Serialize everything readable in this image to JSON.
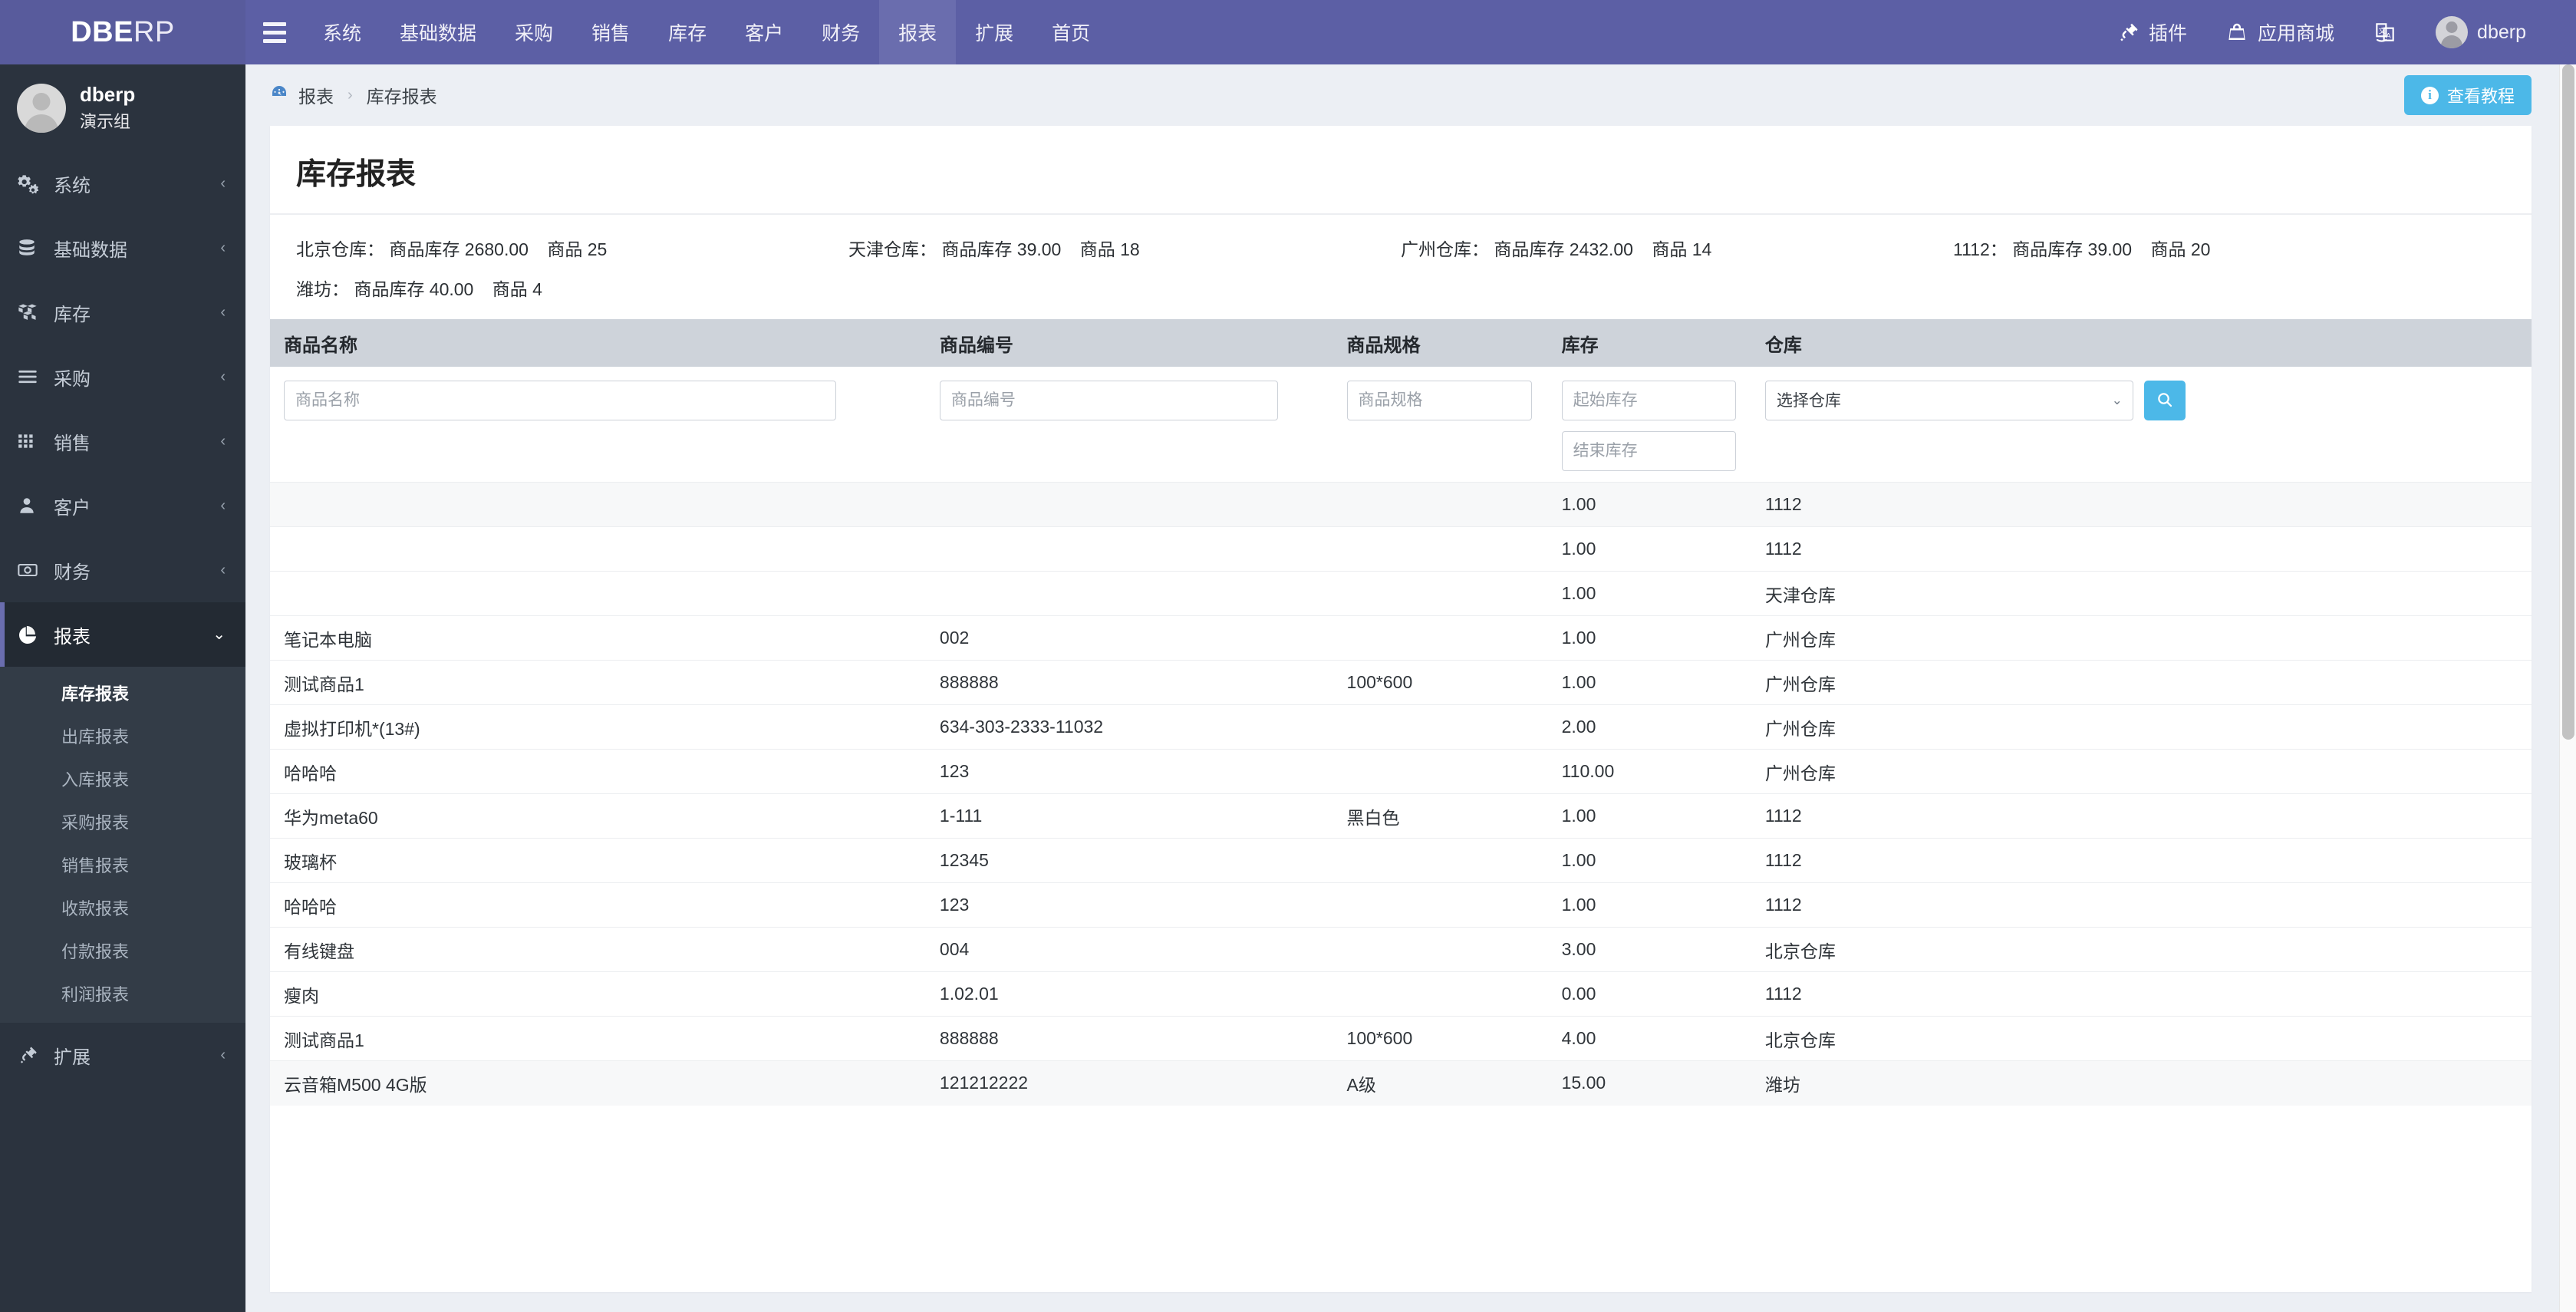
{
  "navbar": {
    "brand_bold": "DBE",
    "brand_light": "RP",
    "toggle_icon": "hamburger-icon",
    "items": [
      {
        "label": "系统",
        "active": false
      },
      {
        "label": "基础数据",
        "active": false
      },
      {
        "label": "采购",
        "active": false
      },
      {
        "label": "销售",
        "active": false
      },
      {
        "label": "库存",
        "active": false
      },
      {
        "label": "客户",
        "active": false
      },
      {
        "label": "财务",
        "active": false
      },
      {
        "label": "报表",
        "active": true
      },
      {
        "label": "扩展",
        "active": false
      },
      {
        "label": "首页",
        "active": false
      }
    ],
    "right": {
      "plugin_label": "插件",
      "store_label": "应用商城",
      "translate_icon": "translate-icon",
      "user_label": "dberp"
    }
  },
  "sidebar": {
    "profile": {
      "name": "dberp",
      "group": "演示组"
    },
    "items": [
      {
        "label": "系统",
        "icon": "gears-icon",
        "caret": "‹"
      },
      {
        "label": "基础数据",
        "icon": "database-icon",
        "caret": "‹"
      },
      {
        "label": "库存",
        "icon": "boxes-icon",
        "caret": "‹"
      },
      {
        "label": "采购",
        "icon": "list-icon",
        "caret": "‹"
      },
      {
        "label": "销售",
        "icon": "grid-icon",
        "caret": "‹"
      },
      {
        "label": "客户",
        "icon": "user-icon",
        "caret": "‹"
      },
      {
        "label": "财务",
        "icon": "money-icon",
        "caret": "‹"
      },
      {
        "label": "报表",
        "icon": "pie-chart-icon",
        "caret": "⌄",
        "open": true
      },
      {
        "label": "扩展",
        "icon": "plug-icon",
        "caret": "‹"
      }
    ],
    "report_submenu": [
      {
        "label": "库存报表",
        "active": true
      },
      {
        "label": "出库报表",
        "active": false
      },
      {
        "label": "入库报表",
        "active": false
      },
      {
        "label": "采购报表",
        "active": false
      },
      {
        "label": "销售报表",
        "active": false
      },
      {
        "label": "收款报表",
        "active": false
      },
      {
        "label": "付款报表",
        "active": false
      },
      {
        "label": "利润报表",
        "active": false
      }
    ]
  },
  "breadcrumb": {
    "icon": "dashboard-icon",
    "root": "报表",
    "separator": "›",
    "leaf": "库存报表"
  },
  "tutorial_button": {
    "label": "查看教程",
    "icon": "info-icon"
  },
  "page": {
    "title": "库存报表"
  },
  "summary": [
    {
      "warehouse": "北京仓库",
      "stock_label": "商品库存",
      "stock": "2680.00",
      "goods_label": "商品",
      "goods": "25"
    },
    {
      "warehouse": "天津仓库",
      "stock_label": "商品库存",
      "stock": "39.00",
      "goods_label": "商品",
      "goods": "18"
    },
    {
      "warehouse": "广州仓库",
      "stock_label": "商品库存",
      "stock": "2432.00",
      "goods_label": "商品",
      "goods": "14"
    },
    {
      "warehouse": "1112",
      "stock_label": "商品库存",
      "stock": "39.00",
      "goods_label": "商品",
      "goods": "20"
    },
    {
      "warehouse": "潍坊",
      "stock_label": "商品库存",
      "stock": "40.00",
      "goods_label": "商品",
      "goods": "4"
    }
  ],
  "table": {
    "headers": [
      "商品名称",
      "商品编号",
      "商品规格",
      "库存",
      "仓库"
    ],
    "filters": {
      "name_placeholder": "商品名称",
      "name_value": "",
      "code_placeholder": "商品编号",
      "code_value": "",
      "spec_placeholder": "商品规格",
      "spec_value": "",
      "stock_start_placeholder": "起始库存",
      "stock_start_value": "",
      "stock_end_placeholder": "结束库存",
      "stock_end_value": "",
      "warehouse_selected": "选择仓库",
      "search_icon": "search-icon"
    },
    "rows": [
      {
        "name": "",
        "code": "",
        "spec": "",
        "stock": "1.00",
        "warehouse": "1112"
      },
      {
        "name": "",
        "code": "",
        "spec": "",
        "stock": "1.00",
        "warehouse": "1112"
      },
      {
        "name": "",
        "code": "",
        "spec": "",
        "stock": "1.00",
        "warehouse": "天津仓库"
      },
      {
        "name": "笔记本电脑",
        "code": "002",
        "spec": "",
        "stock": "1.00",
        "warehouse": "广州仓库"
      },
      {
        "name": "测试商品1",
        "code": "888888",
        "spec": "100*600",
        "stock": "1.00",
        "warehouse": "广州仓库"
      },
      {
        "name": "虚拟打印机*(13#)",
        "code": "634-303-2333-11032",
        "spec": "",
        "stock": "2.00",
        "warehouse": "广州仓库"
      },
      {
        "name": "哈哈哈",
        "code": "123",
        "spec": "",
        "stock": "110.00",
        "warehouse": "广州仓库"
      },
      {
        "name": "华为meta60",
        "code": "1-111",
        "spec": "黑白色",
        "stock": "1.00",
        "warehouse": "1112"
      },
      {
        "name": "玻璃杯",
        "code": "12345",
        "spec": "",
        "stock": "1.00",
        "warehouse": "1112"
      },
      {
        "name": "哈哈哈",
        "code": "123",
        "spec": "",
        "stock": "1.00",
        "warehouse": "1112"
      },
      {
        "name": "有线键盘",
        "code": "004",
        "spec": "",
        "stock": "3.00",
        "warehouse": "北京仓库"
      },
      {
        "name": "瘦肉",
        "code": "1.02.01",
        "spec": "",
        "stock": "0.00",
        "warehouse": "1112"
      },
      {
        "name": "测试商品1",
        "code": "888888",
        "spec": "100*600",
        "stock": "4.00",
        "warehouse": "北京仓库"
      },
      {
        "name": "云音箱M500 4G版",
        "code": "121212222",
        "spec": "A级",
        "stock": "15.00",
        "warehouse": "潍坊"
      }
    ]
  }
}
